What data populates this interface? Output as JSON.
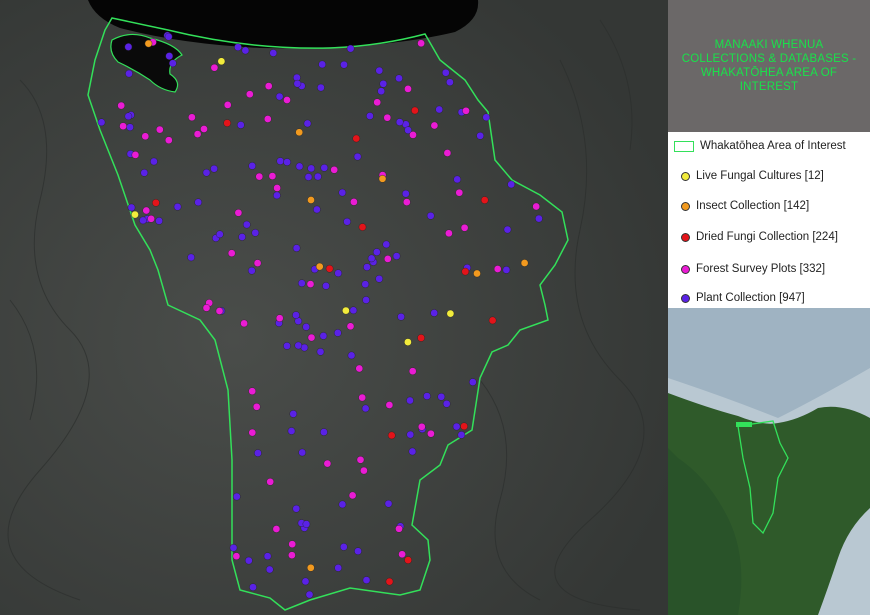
{
  "title": "MANAAKI WHENUA COLLECTIONS & DATABASES - WHAKATŌHEA AREA OF INTEREST",
  "legend": {
    "boundary_label": "Whakatōhea Area of Interest",
    "boundary_color": "#33e05a",
    "items": [
      {
        "label": "Live Fungal Cultures [12]",
        "color": "#f2ec3c"
      },
      {
        "label": "Insect Collection [142]",
        "color": "#f29a1f"
      },
      {
        "label": "Dried Fungi Collection [224]",
        "color": "#e3141a"
      },
      {
        "label": "Forest Survey Plots [332]",
        "color": "#ea1cd4"
      },
      {
        "label": "Plant Collection [947]",
        "color": "#5a22e6"
      }
    ]
  },
  "colors": {
    "terrain": "#3d403e",
    "sea": "#050505",
    "panel": "#6b6868",
    "title_text": "#19e24a"
  }
}
